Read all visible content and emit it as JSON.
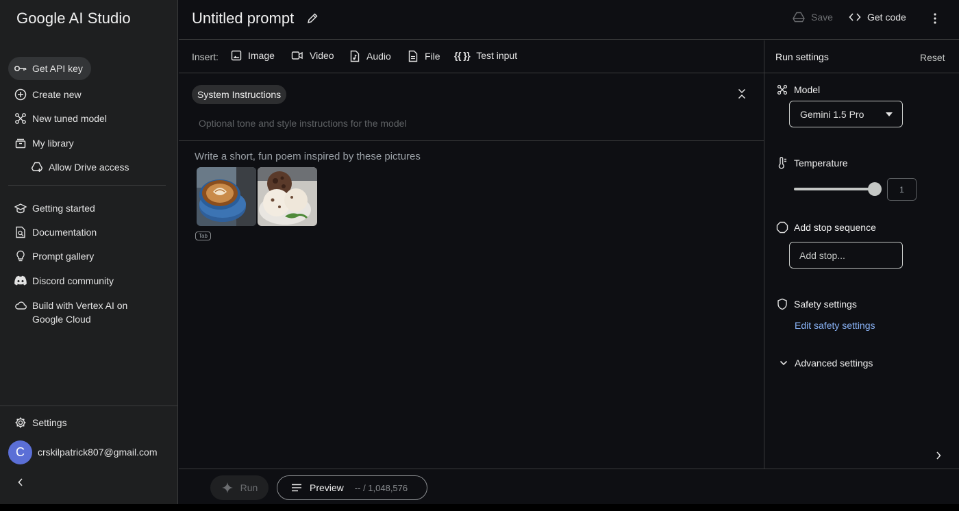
{
  "sidebar": {
    "logo": "Google AI Studio",
    "items": [
      {
        "label": "Get API key",
        "icon": "key-icon"
      },
      {
        "label": "Create new",
        "icon": "plus-circle-icon"
      },
      {
        "label": "New tuned model",
        "icon": "tune-icon"
      },
      {
        "label": "My library",
        "icon": "library-icon"
      },
      {
        "label": "Allow Drive access",
        "icon": "drive-icon"
      },
      {
        "label": "Getting started",
        "icon": "school-icon"
      },
      {
        "label": "Documentation",
        "icon": "docs-icon"
      },
      {
        "label": "Prompt gallery",
        "icon": "lightbulb-icon"
      },
      {
        "label": "Discord community",
        "icon": "discord-icon"
      },
      {
        "label": "Build with Vertex AI on",
        "label2": "Google Cloud",
        "icon": "cloud-icon"
      },
      {
        "label": "Settings",
        "icon": "gear-icon"
      }
    ],
    "user": {
      "initial": "C",
      "email": "crskilpatrick807@gmail.com"
    }
  },
  "header": {
    "title": "Untitled prompt",
    "save_label": "Save",
    "getcode_label": "Get code"
  },
  "insert": {
    "label": "Insert:",
    "items": [
      "Image",
      "Video",
      "Audio",
      "File",
      "Test input"
    ],
    "test_input_glyph": "{{ }}"
  },
  "system": {
    "chip": "System Instructions",
    "placeholder": "Optional tone and style instructions for the model"
  },
  "prompt": {
    "text": "Write a short, fun poem inspired by these pictures",
    "tab_badge": "Tab"
  },
  "run_settings": {
    "title": "Run settings",
    "reset": "Reset",
    "model_label": "Model",
    "model_value": "Gemini 1.5 Pro",
    "temperature_label": "Temperature",
    "temperature_value": "1",
    "stop_label": "Add stop sequence",
    "stop_placeholder": "Add stop...",
    "safety_label": "Safety settings",
    "safety_link": "Edit safety settings",
    "advanced_label": "Advanced settings"
  },
  "bottom": {
    "run_label": "Run",
    "preview_label": "Preview",
    "token_count": "-- / 1,048,576"
  },
  "colors": {
    "background": "#0e0f13",
    "sidebar": "#1e1f20",
    "link": "#8ab4f8",
    "avatar": "#5b6fd6"
  }
}
